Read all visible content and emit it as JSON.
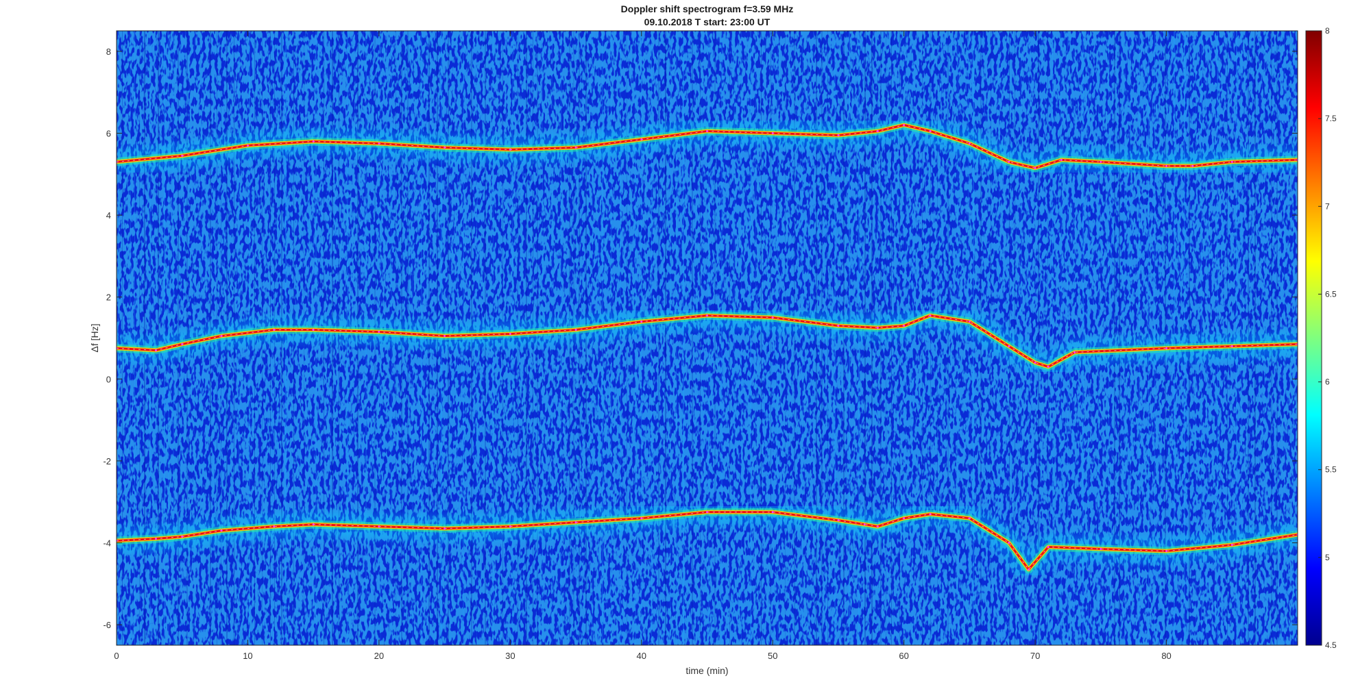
{
  "chart_data": {
    "type": "heatmap",
    "title": "Doppler shift spectrogram f=3.59 MHz",
    "subtitle": "09.10.2018   T start: 23:00 UT",
    "xlabel": "time (min)",
    "ylabel": "Δf [Hz]",
    "xlim": [
      0,
      90
    ],
    "ylim": [
      -6.5,
      8.5
    ],
    "x_ticks": [
      "0",
      "10",
      "20",
      "30",
      "40",
      "50",
      "60",
      "70",
      "80"
    ],
    "y_ticks": [
      "-6",
      "-4",
      "-2",
      "0",
      "2",
      "4",
      "6",
      "8"
    ],
    "colorbar": {
      "colormap": "jet",
      "range": [
        4.5,
        8
      ],
      "ticks": [
        "4.5",
        "5",
        "5.5",
        "6",
        "6.5",
        "7",
        "7.5",
        "8"
      ]
    },
    "grid": false,
    "legend": "none",
    "series": [
      {
        "x": [
          0,
          5,
          10,
          15,
          20,
          25,
          30,
          35,
          40,
          45,
          50,
          55,
          58,
          60,
          62,
          65,
          68,
          70,
          72,
          75,
          80,
          82,
          85,
          90
        ],
        "y": [
          5.3,
          5.45,
          5.7,
          5.8,
          5.75,
          5.65,
          5.6,
          5.65,
          5.85,
          6.05,
          6.0,
          5.95,
          6.05,
          6.2,
          6.05,
          5.75,
          5.3,
          5.15,
          5.35,
          5.3,
          5.2,
          5.2,
          5.3,
          5.35
        ]
      },
      {
        "x": [
          0,
          3,
          5,
          8,
          12,
          15,
          20,
          25,
          30,
          35,
          40,
          45,
          50,
          55,
          58,
          60,
          62,
          65,
          68,
          70,
          71,
          73,
          80,
          85,
          90
        ],
        "y": [
          0.75,
          0.7,
          0.85,
          1.05,
          1.2,
          1.2,
          1.15,
          1.05,
          1.1,
          1.2,
          1.4,
          1.55,
          1.5,
          1.3,
          1.25,
          1.3,
          1.55,
          1.4,
          0.8,
          0.4,
          0.3,
          0.65,
          0.75,
          0.8,
          0.85
        ]
      },
      {
        "x": [
          0,
          3,
          5,
          8,
          12,
          15,
          20,
          25,
          30,
          35,
          40,
          45,
          50,
          55,
          57,
          58,
          60,
          62,
          65,
          68,
          69.5,
          71,
          75,
          80,
          85,
          90
        ],
        "y": [
          -3.95,
          -3.9,
          -3.85,
          -3.7,
          -3.6,
          -3.55,
          -3.6,
          -3.65,
          -3.6,
          -3.5,
          -3.4,
          -3.25,
          -3.25,
          -3.45,
          -3.55,
          -3.6,
          -3.4,
          -3.3,
          -3.4,
          -4.0,
          -4.65,
          -4.1,
          -4.15,
          -4.2,
          -4.05,
          -3.8
        ]
      }
    ]
  }
}
